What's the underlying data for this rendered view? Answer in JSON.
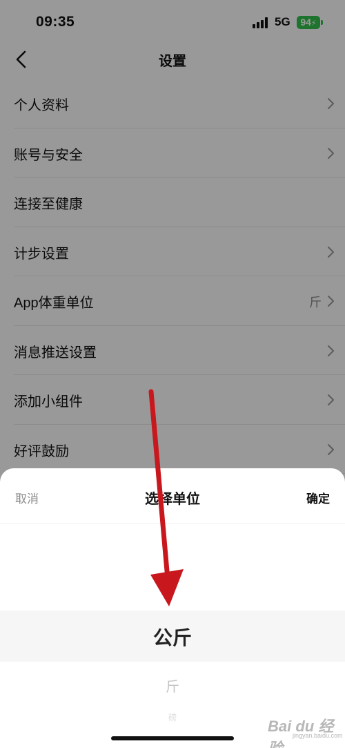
{
  "status_bar": {
    "time": "09:35",
    "network": "5G",
    "battery": "94",
    "battery_color": "#33c24d"
  },
  "navbar": {
    "title": "设置",
    "back_icon": "chevron-left-icon"
  },
  "settings_list": [
    {
      "label": "个人资料",
      "value": "",
      "chevron": true
    },
    {
      "label": "账号与安全",
      "value": "",
      "chevron": true
    },
    {
      "label": "连接至健康",
      "value": "",
      "chevron": false
    },
    {
      "label": "计步设置",
      "value": "",
      "chevron": true
    },
    {
      "label": "App体重单位",
      "value": "斤",
      "chevron": true
    },
    {
      "label": "消息推送设置",
      "value": "",
      "chevron": true
    },
    {
      "label": "添加小组件",
      "value": "",
      "chevron": true
    },
    {
      "label": "好评鼓励",
      "value": "",
      "chevron": true
    }
  ],
  "sheet": {
    "cancel_label": "取消",
    "title": "选择单位",
    "confirm_label": "确定",
    "options": {
      "selected": "公斤",
      "next": "斤",
      "far": "磅"
    }
  },
  "annotation": {
    "arrow_color": "#c8171d"
  },
  "watermark": {
    "text": "Bai du 经验",
    "sub": "jingyan.baidu.com"
  }
}
